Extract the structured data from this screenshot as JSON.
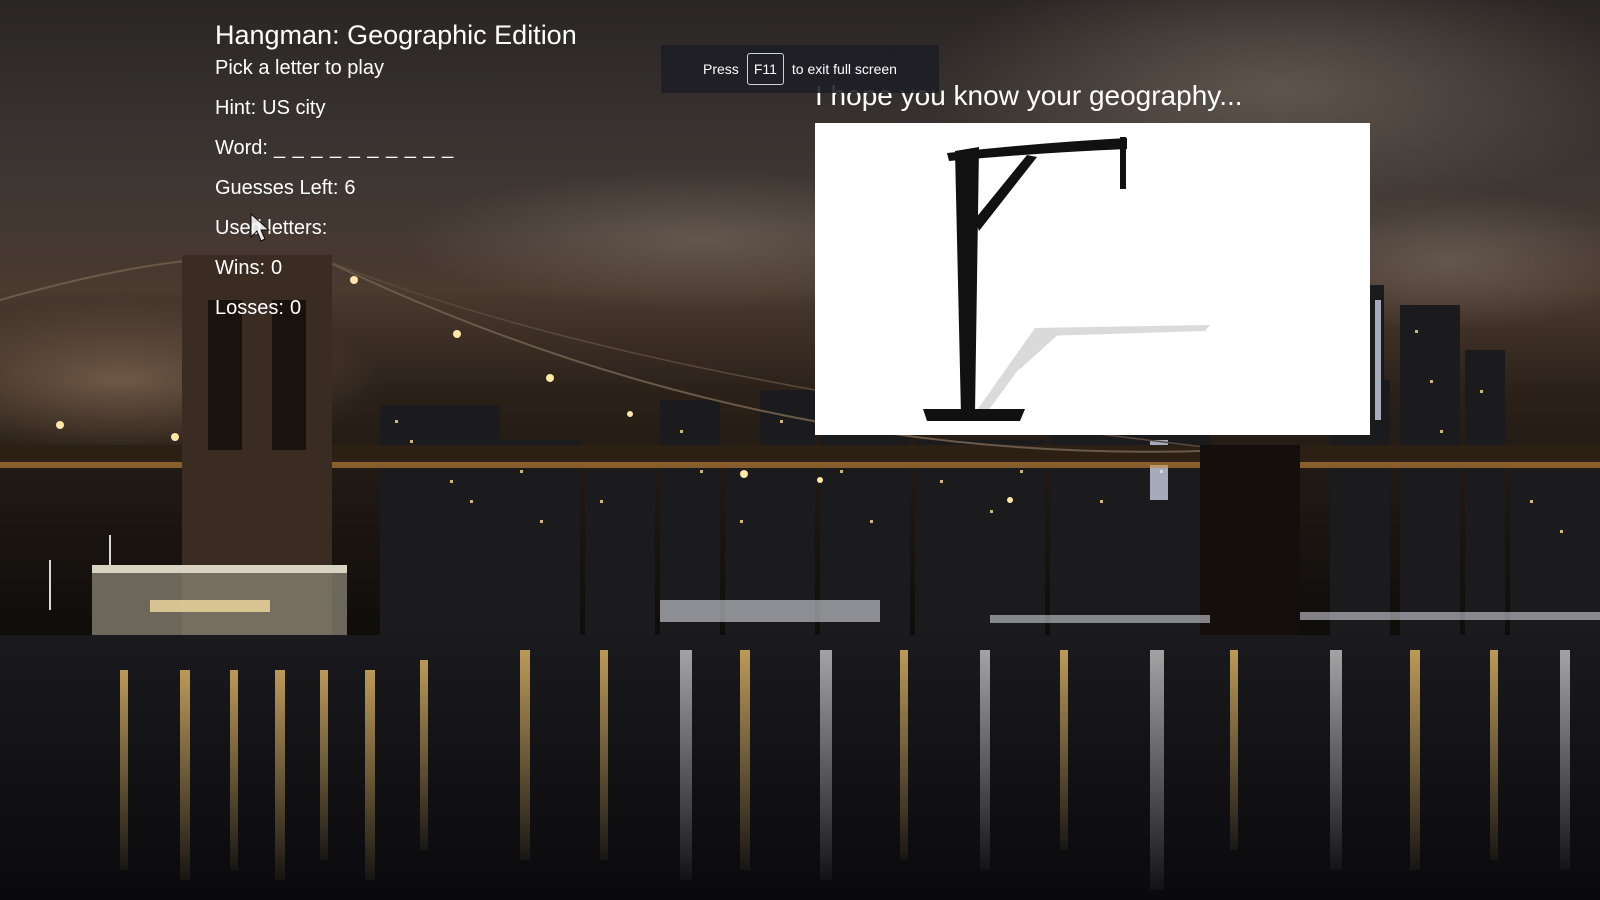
{
  "game": {
    "title": "Hangman: Geographic Edition",
    "instruction": "Pick a letter to play",
    "hint_label": "Hint:",
    "hint_value": "US city",
    "word_label": "Word:",
    "word_blanks": "_ _ _ _ _ _ _ _ _ _",
    "guesses_left_label": "Guesses Left:",
    "guesses_left_value": "6",
    "used_letters_label": "Used letters:",
    "used_letters_value": "",
    "wins_label": "Wins:",
    "wins_value": "0",
    "losses_label": "Losses:",
    "losses_value": "0"
  },
  "board": {
    "tagline": "I hope you know your geography..."
  },
  "fullscreen_toast": {
    "prefix": "Press",
    "key": "F11",
    "suffix": "to exit full screen"
  },
  "colors": {
    "text": "#ffffff",
    "board_bg": "#ffffff",
    "toast_bg": "#1c1e24"
  },
  "icons": {
    "gallows": "gallows-drawing",
    "cursor": "mouse-pointer-icon"
  }
}
